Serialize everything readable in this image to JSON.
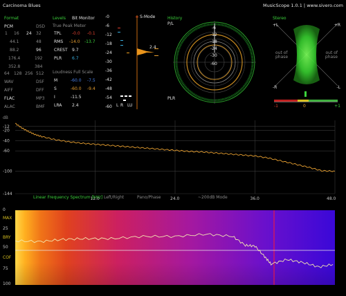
{
  "app": {
    "title": "Carcinoma Blues",
    "version_text": "MusicScope 1.0.1 | www.sivero.com"
  },
  "format": {
    "heading": "Format",
    "row1": [
      "PCM",
      "DSD"
    ],
    "row2": [
      "1",
      "16",
      "24",
      "32"
    ],
    "rates": [
      [
        "44.1",
        "48"
      ],
      [
        "88.2",
        "96"
      ],
      [
        "176.4",
        "192"
      ],
      [
        "352.8",
        "384"
      ]
    ],
    "dsd_rates": [
      "64",
      "128",
      "256",
      "512"
    ],
    "types": [
      [
        "WAV",
        "DSF"
      ],
      [
        "AIFF",
        "DFF"
      ],
      [
        "FLAC",
        "MP3"
      ],
      [
        "ALAC",
        "BMF"
      ]
    ]
  },
  "levels": {
    "heading": "Levels",
    "bit_monitor": "Bit Monitor",
    "tpm_heading": "True Peak Meter",
    "rows": [
      {
        "label": "TPL",
        "l": "-0.0",
        "r": "-0.1"
      },
      {
        "label": "RMS",
        "l": "-14.0",
        "r": "-13.7"
      },
      {
        "label": "CREST",
        "v": "9.7"
      },
      {
        "label": "PLR",
        "v": "6.7"
      }
    ],
    "loud_heading": "Loudness Full Scale",
    "loud_rows": [
      {
        "label": "M",
        "l": "-60.0",
        "r": "-7.5"
      },
      {
        "label": "S",
        "l": "-60.0",
        "r": "-9.4"
      },
      {
        "label": "I",
        "v": "-11.5"
      },
      {
        "label": "LRA",
        "v": "2.4"
      }
    ]
  },
  "meter": {
    "smode": "S-Mode",
    "scale": [
      "-0",
      "-6",
      "-12",
      "-18",
      "-24",
      "-30",
      "-36",
      "-42",
      "-48",
      "-54",
      "-60"
    ],
    "lra_value": "2.4",
    "legend": [
      "L",
      "R",
      "LU"
    ]
  },
  "history": {
    "heading": "History",
    "pl": "P/L",
    "plr": "PLR",
    "rings": [
      "-6",
      "-12",
      "-18",
      "-24",
      "-30",
      "-60"
    ]
  },
  "stereo": {
    "heading": "Stereo",
    "pl": "+L",
    "pr": "+R",
    "ml": "-L",
    "mr": "-R",
    "out_phase_1": "out of phase",
    "out_phase_2": "out of phase",
    "corr_ticks": [
      "-1",
      "0",
      "+1"
    ]
  },
  "spectrum": {
    "db_label": "dB",
    "y_ticks": [
      "-12",
      "-20",
      "-40",
      "-60",
      "-100",
      "-144"
    ],
    "footer": "Linear Frequency Spectrum [kHz]",
    "x_ticks": [
      "12.0",
      "24.0",
      "36.0",
      "48.0"
    ],
    "opts": [
      "Left/Right",
      "Pano/Phase",
      "~200dB Mode"
    ]
  },
  "spectrogram": {
    "y_labels": [
      "0",
      "MAX",
      "25",
      "BRY",
      "50",
      "COF",
      "75",
      "100"
    ]
  },
  "colors": {
    "green": "#3cd23c",
    "orange": "#e8a030",
    "red": "#e04030",
    "cyan": "#3ab0e0"
  },
  "chart_data": [
    {
      "type": "line",
      "title": "Linear Frequency Spectrum [kHz]",
      "xlabel": "kHz",
      "ylabel": "dB",
      "xlim": [
        0,
        48
      ],
      "ylim": [
        -144,
        0
      ],
      "x": [
        0,
        1,
        2,
        3,
        4,
        6,
        8,
        10,
        12,
        14,
        16,
        18,
        20,
        22,
        24,
        26,
        28,
        30,
        32,
        34,
        36,
        38,
        40,
        42,
        44,
        46,
        48
      ],
      "y": [
        -6,
        -15,
        -22,
        -28,
        -32,
        -38,
        -42,
        -45,
        -47,
        -49,
        -51,
        -53,
        -55,
        -57,
        -59,
        -61,
        -62,
        -64,
        -66,
        -68,
        -70,
        -74,
        -80,
        -86,
        -92,
        -99,
        -100
      ]
    },
    {
      "type": "heatmap",
      "title": "",
      "ylim": [
        0,
        100
      ],
      "line_x_pct": [
        0,
        8,
        15,
        22,
        30,
        40,
        50,
        60,
        68,
        72,
        75,
        78,
        80,
        85,
        90,
        95,
        100
      ],
      "line_y": [
        41,
        42,
        39,
        38,
        38,
        35,
        35,
        32,
        35,
        47,
        48,
        62,
        72,
        66,
        70,
        76,
        72
      ]
    }
  ]
}
